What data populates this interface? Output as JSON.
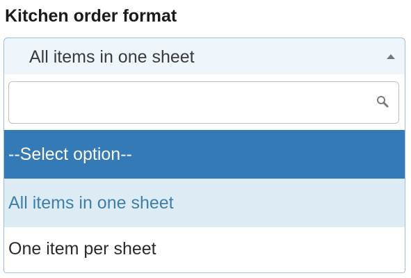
{
  "field": {
    "label": "Kitchen order format"
  },
  "select": {
    "current_value": "All items in one sheet",
    "arrow_icon": "triangle-up-icon"
  },
  "search": {
    "value": "",
    "placeholder": "",
    "icon": "magnifier-icon"
  },
  "options": [
    {
      "label": "--Select option--",
      "state": "selected"
    },
    {
      "label": "All items in one sheet",
      "state": "hovered"
    },
    {
      "label": "One item per sheet",
      "state": "normal"
    }
  ],
  "colors": {
    "selected_bg": "#337ab7",
    "selected_text": "#ffffff",
    "hover_bg": "#ddebf4",
    "hover_text": "#3d7fa8",
    "border": "#9dbfe0"
  }
}
